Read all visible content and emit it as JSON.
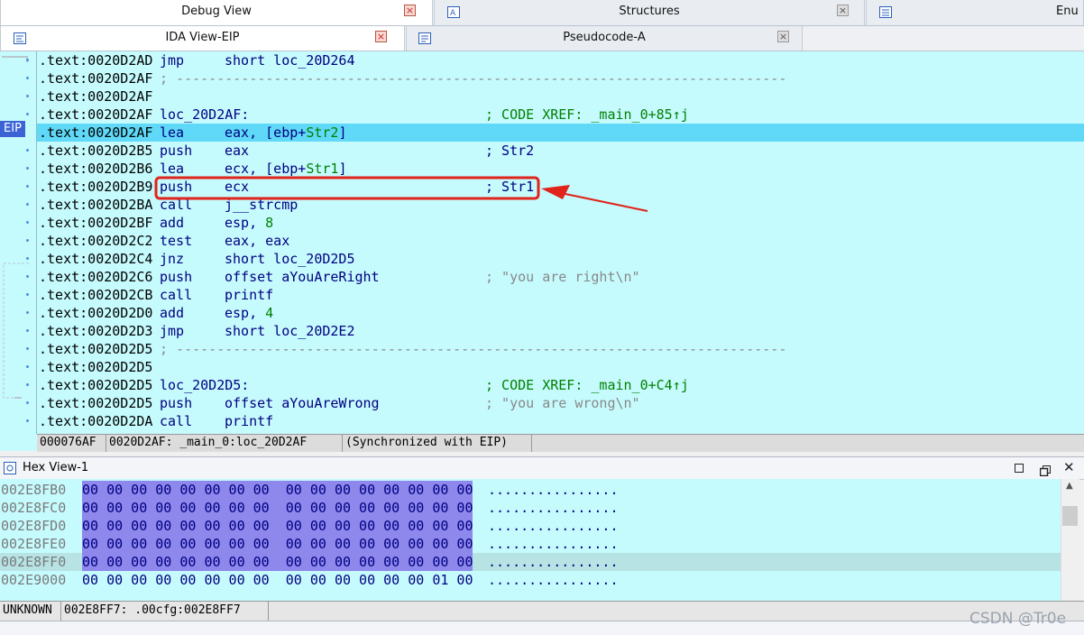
{
  "tabs_top": [
    {
      "label": "Debug View",
      "close": "close-icon"
    },
    {
      "label": "Structures",
      "close": "close-icon"
    },
    {
      "label": "Enu"
    }
  ],
  "tabs_second": [
    {
      "label": "IDA View-EIP",
      "close": "close-icon"
    },
    {
      "label": "Pseudocode-A",
      "close": "close-icon"
    }
  ],
  "eip_label": "EIP",
  "code_lines": [
    {
      "addr": ".text:0020D2AD",
      "mn": "jmp",
      "op": "short loc_20D264",
      "cm": ""
    },
    {
      "addr": ".text:0020D2AF",
      "sep": "; ---------------------------------------------------------------------------"
    },
    {
      "addr": ".text:0020D2AF"
    },
    {
      "addr": ".text:0020D2AF",
      "mn": "loc_20D2AF:",
      "op": "",
      "cm": "; CODE XREF: _main_0+85↑j"
    },
    {
      "addr": ".text:0020D2AF",
      "mn": "lea",
      "op1": "eax, [ebp+",
      "op2": "Str2",
      "op3": "]",
      "cm": ""
    },
    {
      "addr": ".text:0020D2B5",
      "mn": "push",
      "op": "eax",
      "cm": "; Str2"
    },
    {
      "addr": ".text:0020D2B6",
      "mn": "lea",
      "op1": "ecx, [ebp+",
      "op2": "Str1",
      "op3": "]",
      "cm": ""
    },
    {
      "addr": ".text:0020D2B9",
      "mn": "push",
      "op": "ecx",
      "cm": "; Str1"
    },
    {
      "addr": ".text:0020D2BA",
      "mn": "call",
      "op": "j__strcmp",
      "cm": ""
    },
    {
      "addr": ".text:0020D2BF",
      "mn": "add",
      "op1": "esp, ",
      "op2": "8",
      "cm": ""
    },
    {
      "addr": ".text:0020D2C2",
      "mn": "test",
      "op": "eax, eax",
      "cm": ""
    },
    {
      "addr": ".text:0020D2C4",
      "mn": "jnz",
      "op": "short loc_20D2D5",
      "cm": ""
    },
    {
      "addr": ".text:0020D2C6",
      "mn": "push",
      "op": "offset aYouAreRight",
      "cm": "; \"you are right\\n\""
    },
    {
      "addr": ".text:0020D2CB",
      "mn": "call",
      "op": "printf",
      "cm": ""
    },
    {
      "addr": ".text:0020D2D0",
      "mn": "add",
      "op1": "esp, ",
      "op2": "4",
      "cm": ""
    },
    {
      "addr": ".text:0020D2D3",
      "mn": "jmp",
      "op": "short loc_20D2E2",
      "cm": ""
    },
    {
      "addr": ".text:0020D2D5",
      "sep": "; ---------------------------------------------------------------------------"
    },
    {
      "addr": ".text:0020D2D5"
    },
    {
      "addr": ".text:0020D2D5",
      "mn": "loc_20D2D5:",
      "op": "",
      "cm": "; CODE XREF: _main_0+C4↑j"
    },
    {
      "addr": ".text:0020D2D5",
      "mn": "push",
      "op": "offset aYouAreWrong",
      "cm": "; \"you are wrong\\n\""
    },
    {
      "addr": ".text:0020D2DA",
      "mn": "call",
      "op": "printf",
      "cm": ""
    }
  ],
  "ida_status": [
    "000076AF",
    "0020D2AF: _main_0:loc_20D2AF",
    "(Synchronized with EIP)"
  ],
  "hex_title": "Hex View-1",
  "hex_rows": [
    {
      "addr": "002E8FB0",
      "bytes": "00 00 00 00 00 00 00 00  00 00 00 00 00 00 00 00",
      "ascii": "................"
    },
    {
      "addr": "002E8FC0",
      "bytes": "00 00 00 00 00 00 00 00  00 00 00 00 00 00 00 00",
      "ascii": "................"
    },
    {
      "addr": "002E8FD0",
      "bytes": "00 00 00 00 00 00 00 00  00 00 00 00 00 00 00 00",
      "ascii": "................"
    },
    {
      "addr": "002E8FE0",
      "bytes": "00 00 00 00 00 00 00 00  00 00 00 00 00 00 00 00",
      "ascii": "................"
    },
    {
      "addr": "002E8FF0",
      "bytes": "00 00 00 00 00 00 00 00  00 00 00 00 00 00 00 00",
      "ascii": "................"
    },
    {
      "addr": "002E9000",
      "bytes": "00 00 00 00 00 00 00 00  00 00 00 00 00 00 01 00",
      "ascii": "................"
    }
  ],
  "hex_status": [
    "UNKNOWN",
    "002E8FF7: .00cfg:002E8FF7"
  ],
  "watermark": "CSDN @Tr0e",
  "colors": {
    "highlight": "#5fd9f7",
    "annotation": "#e0231b",
    "background": "#c6fbfe"
  }
}
